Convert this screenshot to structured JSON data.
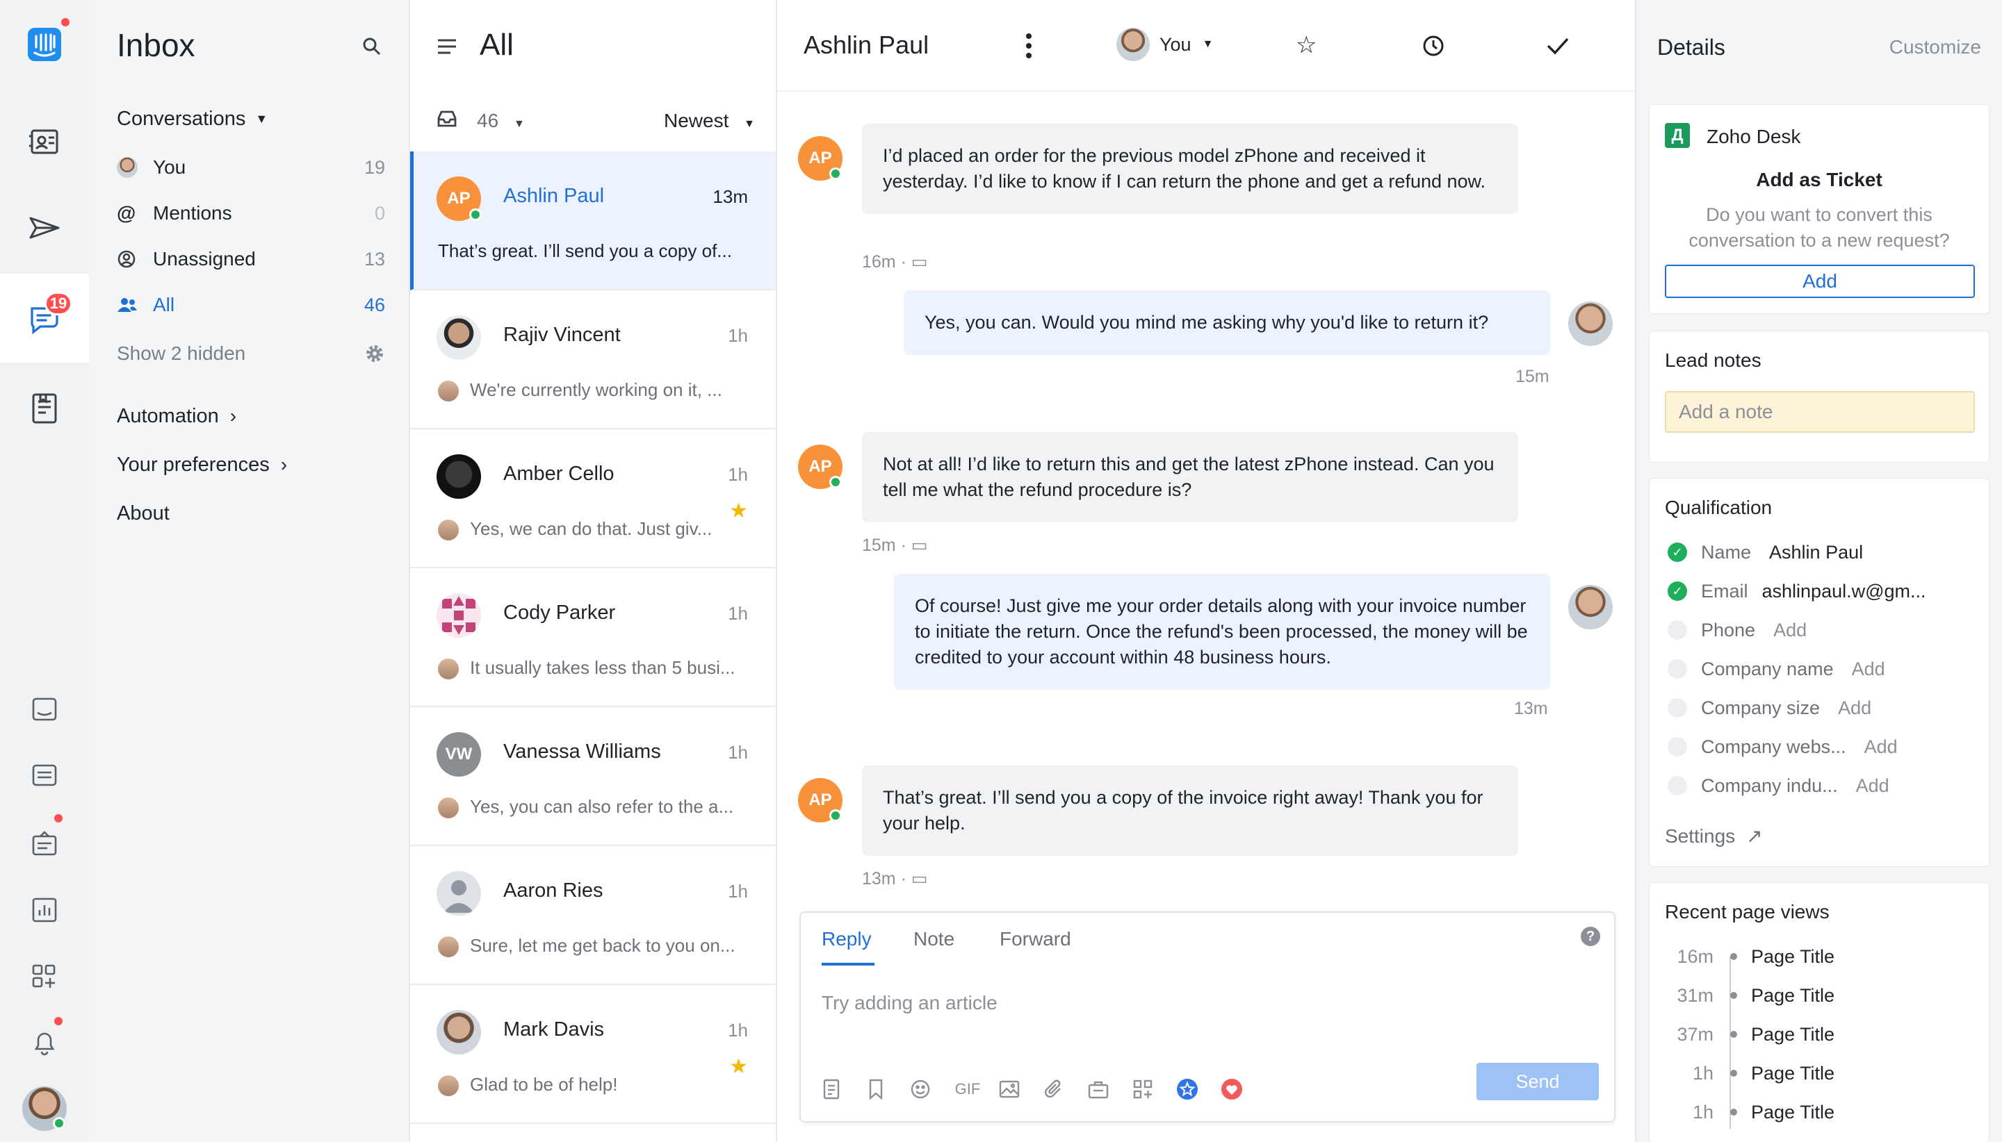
{
  "rail": {
    "badge": "19",
    "icons": [
      "intercom-logo-icon",
      "contacts-icon",
      "outbound-send-icon",
      "inbox-chat-icon",
      "articles-icon",
      "messenger-icon",
      "inbox-tray-icon",
      "operator-icon",
      "reports-icon",
      "apps-icon",
      "notifications-bell-icon",
      "user-avatar"
    ]
  },
  "nav": {
    "title": "Inbox",
    "conversations_label": "Conversations",
    "items": [
      {
        "label": "You",
        "count": "19"
      },
      {
        "label": "Mentions",
        "count": "0"
      },
      {
        "label": "Unassigned",
        "count": "13"
      },
      {
        "label": "All",
        "count": "46"
      }
    ],
    "show_hidden": "Show 2 hidden",
    "automation": "Automation",
    "preferences": "Your preferences",
    "about": "About"
  },
  "list": {
    "title": "All",
    "count": "46",
    "sort": "Newest",
    "conversations": [
      {
        "initials": "AP",
        "name": "Ashlin Paul",
        "time": "13m",
        "preview": "That’s great. I’ll send you a copy of..."
      },
      {
        "initials": "",
        "name": "Rajiv Vincent",
        "time": "1h",
        "preview": "We're currently working on it, ..."
      },
      {
        "initials": "",
        "name": "Amber Cello",
        "time": "1h",
        "preview": "Yes, we can do that. Just giv..."
      },
      {
        "initials": "",
        "name": "Cody Parker",
        "time": "1h",
        "preview": "It usually takes less than 5 busi..."
      },
      {
        "initials": "VW",
        "name": "Vanessa Williams",
        "time": "1h",
        "preview": "Yes, you can also refer to the a..."
      },
      {
        "initials": "",
        "name": "Aaron Ries",
        "time": "1h",
        "preview": "Sure, let me get back to you on..."
      },
      {
        "initials": "",
        "name": "Mark Davis",
        "time": "1h",
        "preview": "Glad to be of help!"
      }
    ]
  },
  "conversation": {
    "title": "Ashlin Paul",
    "assignee": "You",
    "messages": [
      {
        "initials": "AP",
        "text": "I’d placed an order for the previous model zPhone and received it yesterday. I’d like to know if I can return the phone and get a refund now.",
        "meta": "16m ·"
      },
      {
        "text": "Yes, you can. Would you mind me asking why you'd like to return it?",
        "meta": "15m"
      },
      {
        "initials": "AP",
        "text": "Not at all! I’d like to return this and get the latest zPhone instead. Can you tell me what the refund procedure is?",
        "meta": "15m ·"
      },
      {
        "text": "Of course! Just give me your order details along with your invoice number to initiate the return. Once the refund's been processed, the money will be credited to your account within 48 business hours.",
        "meta": "13m"
      },
      {
        "initials": "AP",
        "text": "That’s great. I’ll send you a copy of the invoice right away! Thank you for your help.",
        "meta": "13m ·"
      }
    ],
    "composer": {
      "tabs": [
        "Reply",
        "Note",
        "Forward"
      ],
      "placeholder": "Try adding an article",
      "gif": "GIF",
      "send": "Send",
      "help": "?"
    }
  },
  "details": {
    "title": "Details",
    "customize": "Customize",
    "zoho": {
      "name": "Zoho Desk",
      "heading": "Add as Ticket",
      "body": "Do you want to convert this conversation to a new request?",
      "button": "Add"
    },
    "lead_notes": {
      "title": "Lead notes",
      "placeholder": "Add a note"
    },
    "qualification": {
      "title": "Qualification",
      "rows": [
        {
          "label": "Name",
          "value": "Ashlin Paul",
          "done": true
        },
        {
          "label": "Email",
          "value": "ashlinpaul.w@gm...",
          "done": true
        },
        {
          "label": "Phone",
          "value": "Add",
          "done": false
        },
        {
          "label": "Company name",
          "value": "Add",
          "done": false
        },
        {
          "label": "Company size",
          "value": "Add",
          "done": false
        },
        {
          "label": "Company webs...",
          "value": "Add",
          "done": false
        },
        {
          "label": "Company indu...",
          "value": "Add",
          "done": false
        }
      ],
      "settings": "Settings"
    },
    "page_views": {
      "title": "Recent page views",
      "rows": [
        {
          "time": "16m",
          "title": "Page Title"
        },
        {
          "time": "31m",
          "title": "Page Title"
        },
        {
          "time": "37m",
          "title": "Page Title"
        },
        {
          "time": "1h",
          "title": "Page Title"
        },
        {
          "time": "1h",
          "title": "Page Title"
        }
      ]
    }
  },
  "colors": {
    "accent": "#1f6fd6",
    "avatar_orange": "#f7923a",
    "online": "#23b05b",
    "badge": "#ff4e4e",
    "star": "#f5b800"
  }
}
